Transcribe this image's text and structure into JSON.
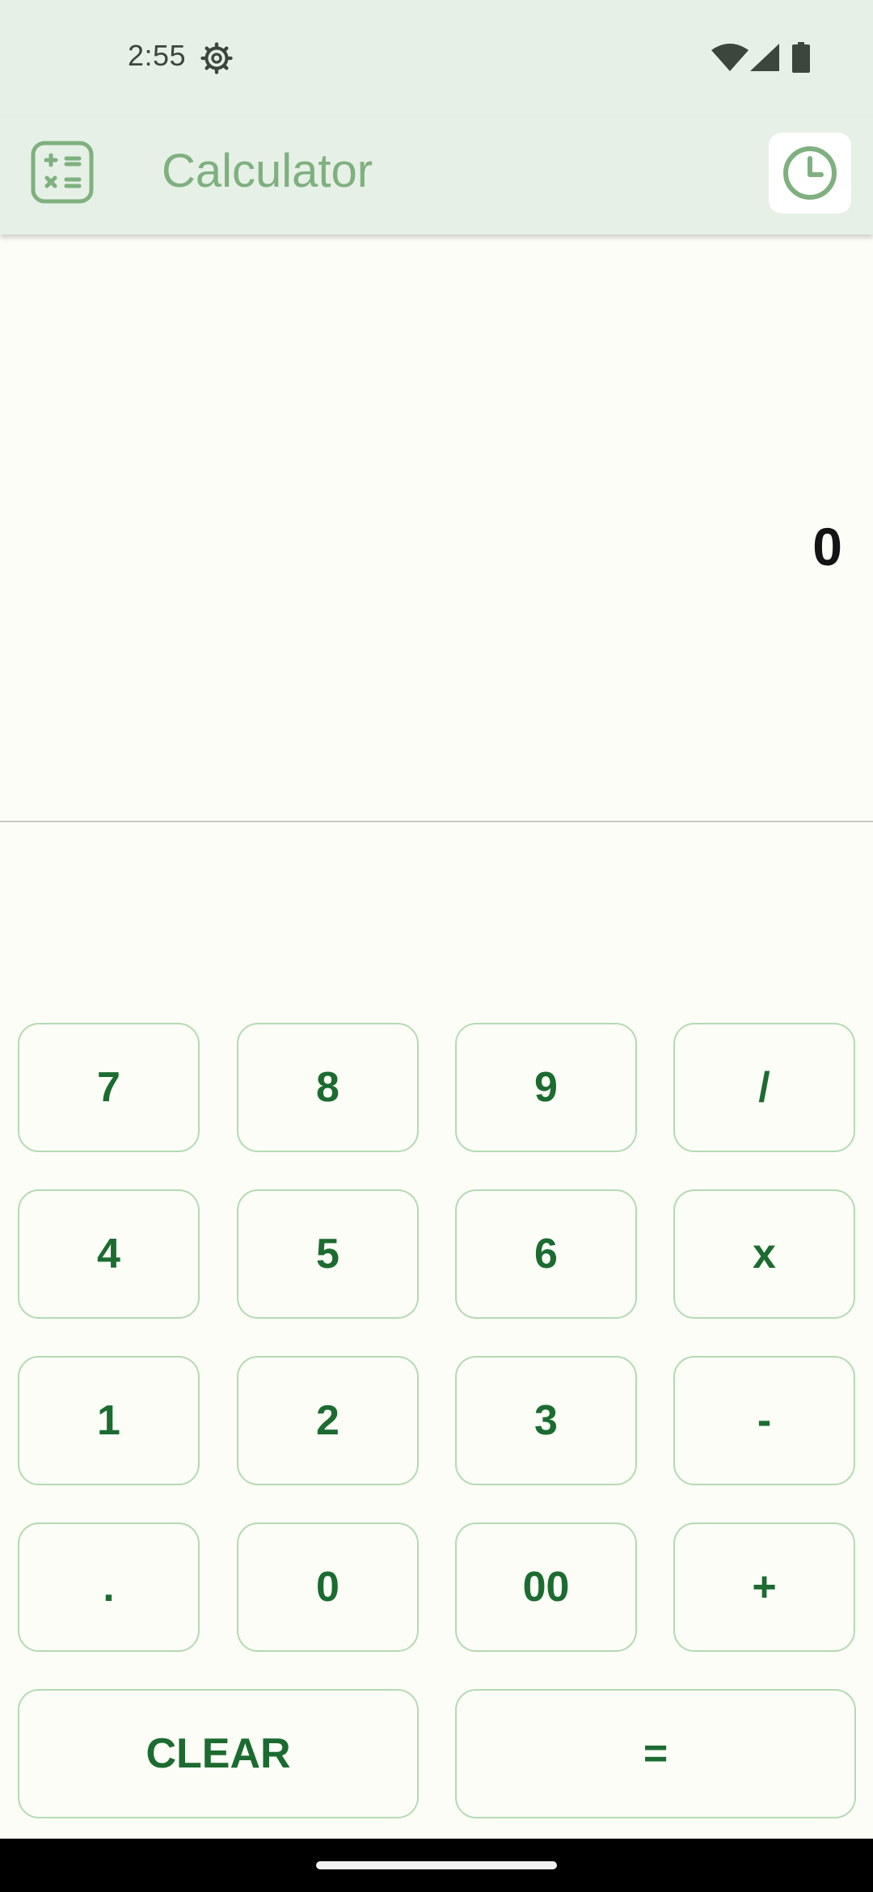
{
  "status_bar": {
    "time": "2:55",
    "icons": [
      "settings-gear-icon",
      "wifi-icon",
      "signal-icon",
      "battery-icon"
    ]
  },
  "app_bar": {
    "title": "Calculator",
    "app_icon": "calculator-icon",
    "history_icon": "clock-icon"
  },
  "display": {
    "value": "0"
  },
  "keypad": {
    "rows": [
      [
        "7",
        "8",
        "9",
        "/"
      ],
      [
        "4",
        "5",
        "6",
        "x"
      ],
      [
        "1",
        "2",
        "3",
        "-"
      ],
      [
        ".",
        "0",
        "00",
        "+"
      ]
    ],
    "clear_label": "CLEAR",
    "equals_label": "="
  },
  "colors": {
    "bar_background": "#e6f0e6",
    "page_background": "#fcfdf7",
    "accent": "#7fb07f",
    "key_text": "#1c6b30",
    "key_border": "#b4dab4"
  }
}
